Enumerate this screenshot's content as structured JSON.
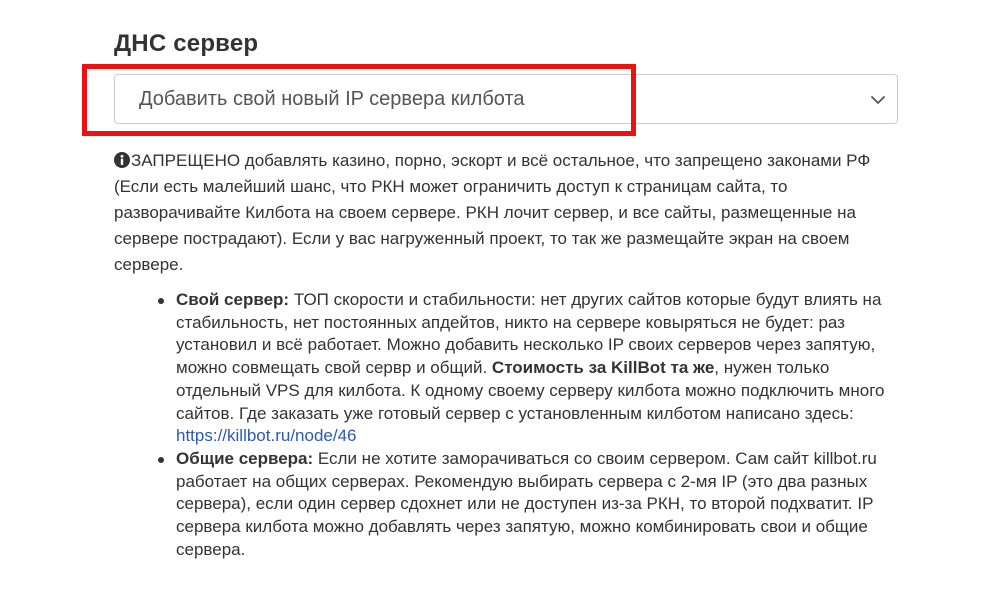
{
  "dns_section": {
    "title": "ДНС сервер",
    "select": {
      "selected_value": "Добавить свой новый IP сервера килбота"
    },
    "help_text": "ЗАПРЕЩЕНО добавлять казино, порно, эскорт и всё остальное, что запрещено законами РФ (Если есть малейший шанс, что РКН может ограничить доступ к страницам сайта, то разворачивайте Килбота на своем сервере. РКН лочит сервер, и все сайты, размещенные на сервере пострадают). Если у вас нагруженный проект, то так же размещайте экран на своем сервере.",
    "options": [
      {
        "label": "Свой сервер:",
        "text_1": " ТОП скорости и стабильности: нет других сайтов которые будут влиять на стабильность, нет постоянных апдейтов, никто на сервере ковыряться не будет: раз установил и всё работает. Можно добавить несколько IP своих серверов через запятую, можно совмещать свой сервр и общий. ",
        "bold_2": "Стоимость за KillBot та же",
        "text_2": ", нужен только отдельный VPS для килбота. К одному своему серверу килбота можно подключить много сайтов. Где заказать уже готовый сервер с установленным килботом написано здесь: ",
        "link": "https://killbot.ru/node/46"
      },
      {
        "label": "Общие сервера:",
        "text_1": " Если не хотите заморачиваться со своим сервером. Сам сайт killbot.ru работает на общих серверах. Рекомендую выбирать сервера с 2-мя IP (это два разных сервера), если один сервер сдохнет или не доступен из-за РКН, то второй подхватит. IP сервера килбота можно добавлять через запятую, можно комбинировать свои и общие сервера."
      }
    ]
  },
  "colors": {
    "highlight": "#ee1111",
    "link": "#2a5ab8",
    "text": "#333333",
    "border": "#cccccc"
  },
  "icons": {
    "info": "info-circle-icon",
    "select_arrow": "chevron-down-icon"
  }
}
